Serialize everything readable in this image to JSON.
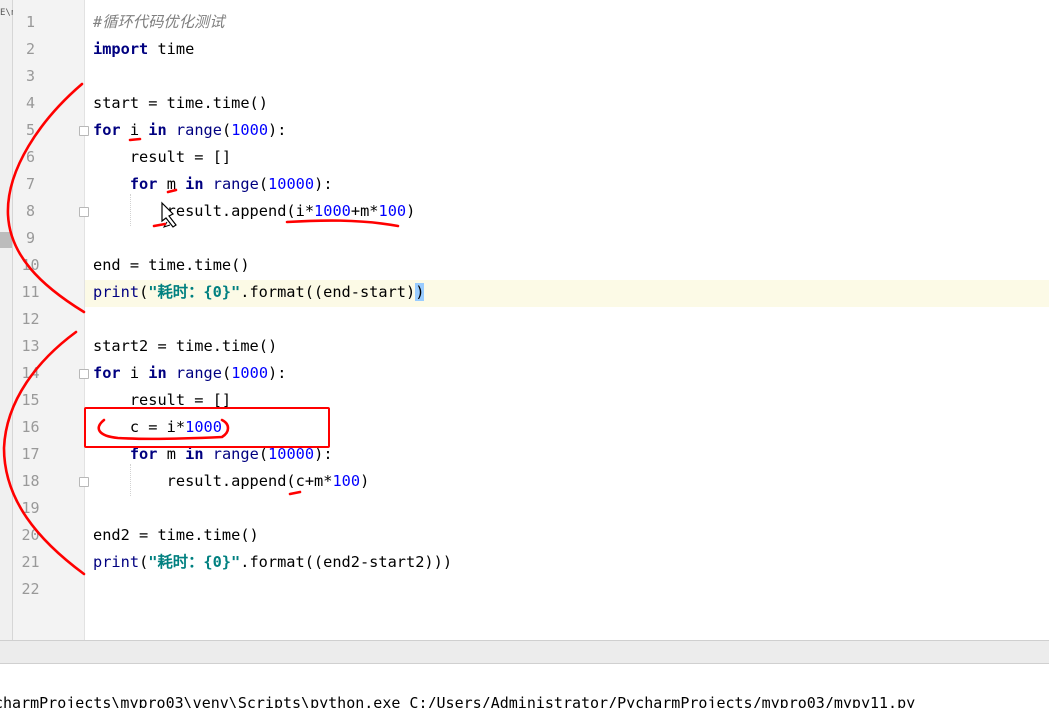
{
  "editor": {
    "left_strip_label": "E\\n",
    "line_numbers": [
      "1",
      "2",
      "3",
      "4",
      "5",
      "6",
      "7",
      "8",
      "9",
      "10",
      "11",
      "12",
      "13",
      "14",
      "15",
      "16",
      "17",
      "18",
      "19",
      "20",
      "21",
      "22"
    ],
    "lines": [
      [
        {
          "t": "#循环代码优化测试",
          "c": "cmt"
        }
      ],
      [
        {
          "t": "import",
          "c": "kw"
        },
        {
          "t": " time"
        }
      ],
      [],
      [
        {
          "t": "start = time.time()"
        }
      ],
      [
        {
          "t": "for",
          "c": "kw"
        },
        {
          "t": " i "
        },
        {
          "t": "in",
          "c": "kw"
        },
        {
          "t": " "
        },
        {
          "t": "range",
          "c": "fn"
        },
        {
          "t": "("
        },
        {
          "t": "1000",
          "c": "num"
        },
        {
          "t": "):"
        }
      ],
      [
        {
          "t": "    result = []"
        }
      ],
      [
        {
          "t": "    "
        },
        {
          "t": "for",
          "c": "kw"
        },
        {
          "t": " m "
        },
        {
          "t": "in",
          "c": "kw"
        },
        {
          "t": " "
        },
        {
          "t": "range",
          "c": "fn"
        },
        {
          "t": "("
        },
        {
          "t": "10000",
          "c": "num"
        },
        {
          "t": "):"
        }
      ],
      [
        {
          "t": "        result.append(i*"
        },
        {
          "t": "1000",
          "c": "num"
        },
        {
          "t": "+m*"
        },
        {
          "t": "100",
          "c": "num"
        },
        {
          "t": ")"
        }
      ],
      [],
      [
        {
          "t": "end = time.time()"
        }
      ],
      [
        {
          "t": "print",
          "c": "fn"
        },
        {
          "t": "("
        },
        {
          "t": "\"耗时：{0}\"",
          "c": "str"
        },
        {
          "t": ".format((end-start)"
        },
        {
          "t": ")",
          "c": "bracehl"
        }
      ],
      [],
      [
        {
          "t": "start2 = time.time()"
        }
      ],
      [
        {
          "t": "for",
          "c": "kw"
        },
        {
          "t": " i "
        },
        {
          "t": "in",
          "c": "kw"
        },
        {
          "t": " "
        },
        {
          "t": "range",
          "c": "fn"
        },
        {
          "t": "("
        },
        {
          "t": "1000",
          "c": "num"
        },
        {
          "t": "):"
        }
      ],
      [
        {
          "t": "    result = []"
        }
      ],
      [
        {
          "t": "    c = i*"
        },
        {
          "t": "1000",
          "c": "num"
        }
      ],
      [
        {
          "t": "    "
        },
        {
          "t": "for",
          "c": "kw"
        },
        {
          "t": " m "
        },
        {
          "t": "in",
          "c": "kw"
        },
        {
          "t": " "
        },
        {
          "t": "range",
          "c": "fn"
        },
        {
          "t": "("
        },
        {
          "t": "10000",
          "c": "num"
        },
        {
          "t": "):"
        }
      ],
      [
        {
          "t": "        result.append(c+m*"
        },
        {
          "t": "100",
          "c": "num"
        },
        {
          "t": ")"
        }
      ],
      [],
      [
        {
          "t": "end2 = time.time()"
        }
      ],
      [
        {
          "t": "print",
          "c": "fn"
        },
        {
          "t": "("
        },
        {
          "t": "\"耗时：{0}\"",
          "c": "str"
        },
        {
          "t": ".format((end2-start2)))"
        }
      ],
      []
    ]
  },
  "console": {
    "command": "charmProjects\\mypro03\\venv\\Scripts\\python.exe C:/Users/Administrator/PycharmProjects/mypro03/mypy11.py"
  },
  "colors": {
    "keyword": "#000080",
    "number": "#0000ff",
    "string": "#008080",
    "comment": "#808080",
    "annotation": "#ff0000",
    "current_line": "#fcfae6"
  },
  "icons": [
    "fold-marker-icon",
    "pen-cursor-icon"
  ]
}
